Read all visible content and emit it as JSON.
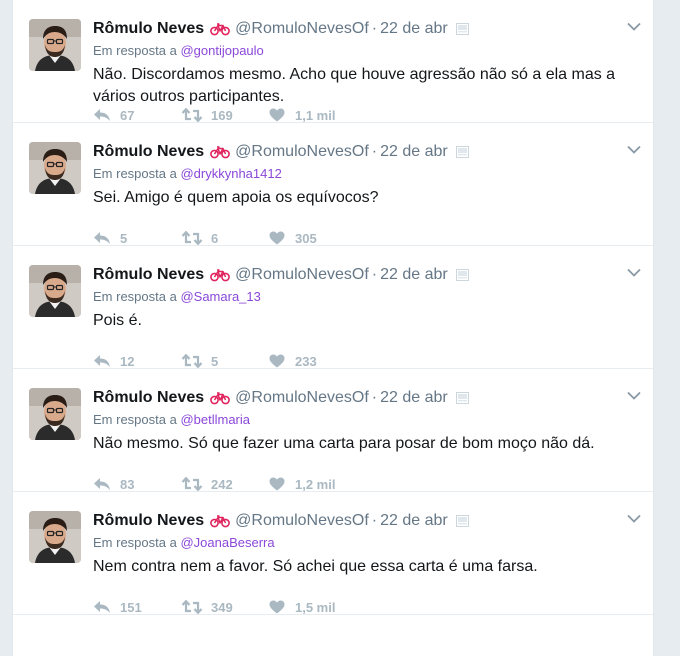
{
  "colors": {
    "mention": "#8b48d9",
    "muted": "#657786",
    "action": "#aab8c2",
    "bike": "#e0245e"
  },
  "icons": {
    "reply": "reply-icon",
    "retweet": "retweet-icon",
    "like": "heart-icon",
    "caret": "chevron-down-icon",
    "bike": "bicycle-emoji-icon",
    "card": "photo-card-icon"
  },
  "tweets": [
    {
      "name": "Rômulo Neves",
      "handle": "@RomuloNevesOf",
      "sep": "·",
      "time": "22 de abr",
      "reply_prefix": "Em resposta a",
      "reply_to": "@gontijopaulo",
      "text": "Não. Discordamos mesmo. Acho que houve agressão não só a ela mas a vários outros participantes.",
      "replies": "67",
      "retweets": "169",
      "likes": "1,1 mil"
    },
    {
      "name": "Rômulo Neves",
      "handle": "@RomuloNevesOf",
      "sep": "·",
      "time": "22 de abr",
      "reply_prefix": "Em resposta a",
      "reply_to": "@drykkynha1412",
      "text": "Sei. Amigo é quem apoia os equívocos?",
      "replies": "5",
      "retweets": "6",
      "likes": "305"
    },
    {
      "name": "Rômulo Neves",
      "handle": "@RomuloNevesOf",
      "sep": "·",
      "time": "22 de abr",
      "reply_prefix": "Em resposta a",
      "reply_to": "@Samara_13",
      "text": "Pois é.",
      "replies": "12",
      "retweets": "5",
      "likes": "233"
    },
    {
      "name": "Rômulo Neves",
      "handle": "@RomuloNevesOf",
      "sep": "·",
      "time": "22 de abr",
      "reply_prefix": "Em resposta a",
      "reply_to": "@betllmaria",
      "text": "Não mesmo. Só que fazer uma carta para posar de bom moço não dá.",
      "replies": "83",
      "retweets": "242",
      "likes": "1,2 mil"
    },
    {
      "name": "Rômulo Neves",
      "handle": "@RomuloNevesOf",
      "sep": "·",
      "time": "22 de abr",
      "reply_prefix": "Em resposta a",
      "reply_to": "@JoanaBeserra",
      "text": "Nem contra nem a favor. Só achei que essa carta é uma farsa.",
      "replies": "151",
      "retweets": "349",
      "likes": "1,5 mil"
    }
  ]
}
